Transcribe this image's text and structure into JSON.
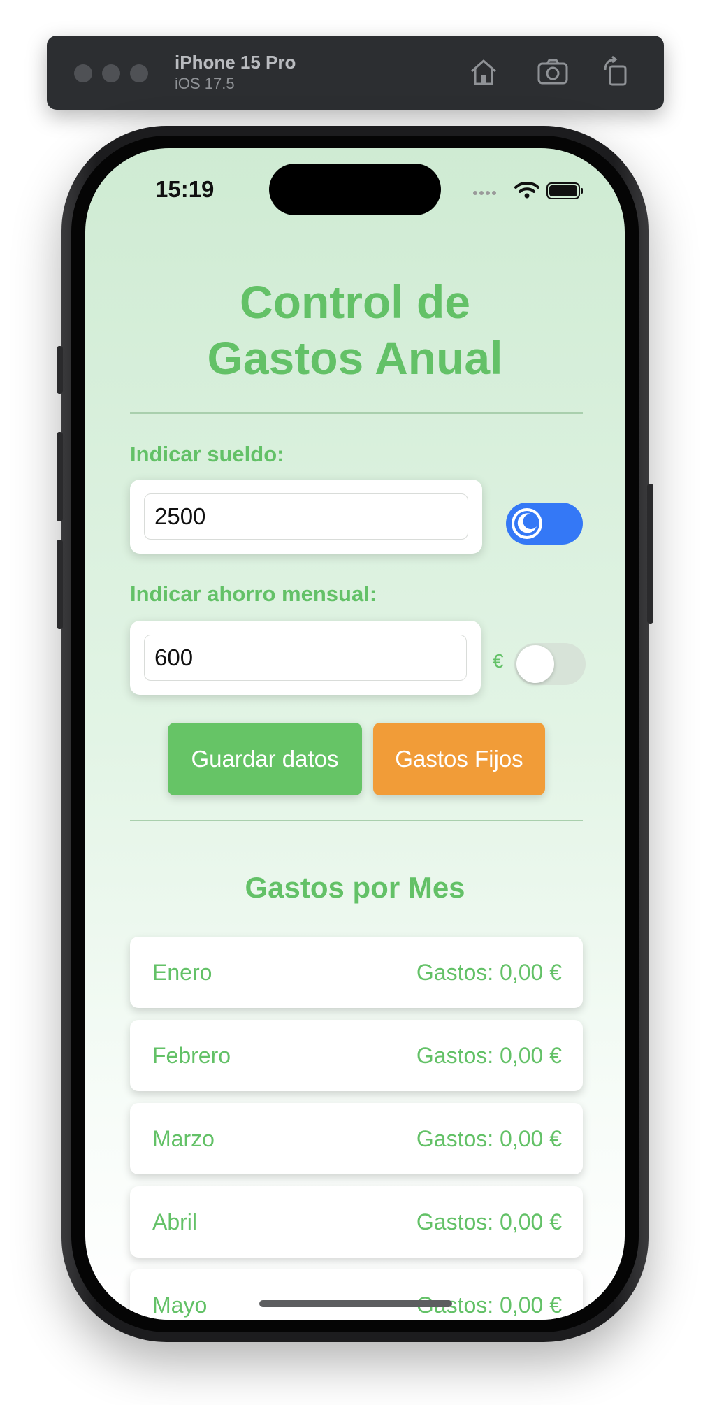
{
  "simulator": {
    "device_name": "iPhone 15 Pro",
    "os_version": "iOS 17.5",
    "toolbar_icons": [
      "home-icon",
      "screenshot-icon",
      "rotate-icon"
    ]
  },
  "status_bar": {
    "time": "15:19",
    "icons": [
      "signal-icon",
      "wifi-icon",
      "battery-icon"
    ]
  },
  "app": {
    "title_line1": "Control de",
    "title_line2": "Gastos Anual",
    "salary": {
      "label": "Indicar sueldo:",
      "value": "2500"
    },
    "dark_mode_toggle": {
      "state": "on",
      "icon": "moon-icon",
      "color": "#3478f6"
    },
    "savings": {
      "label": "Indicar ahorro mensual:",
      "value": "600",
      "unit": "€"
    },
    "currency_toggle": {
      "state": "off"
    },
    "buttons": {
      "save": "Guardar datos",
      "fixed_expenses": "Gastos Fijos"
    },
    "section_title": "Gastos por Mes",
    "months": [
      {
        "name": "Enero",
        "expenses": "Gastos: 0,00 €"
      },
      {
        "name": "Febrero",
        "expenses": "Gastos: 0,00 €"
      },
      {
        "name": "Marzo",
        "expenses": "Gastos: 0,00 €"
      },
      {
        "name": "Abril",
        "expenses": "Gastos: 0,00 €"
      },
      {
        "name": "Mayo",
        "expenses": "Gastos: 0,00 €"
      }
    ]
  },
  "colors": {
    "accent_green": "#63c167",
    "button_green": "#66c466",
    "button_orange": "#f19c38",
    "toggle_blue": "#3478f6"
  }
}
